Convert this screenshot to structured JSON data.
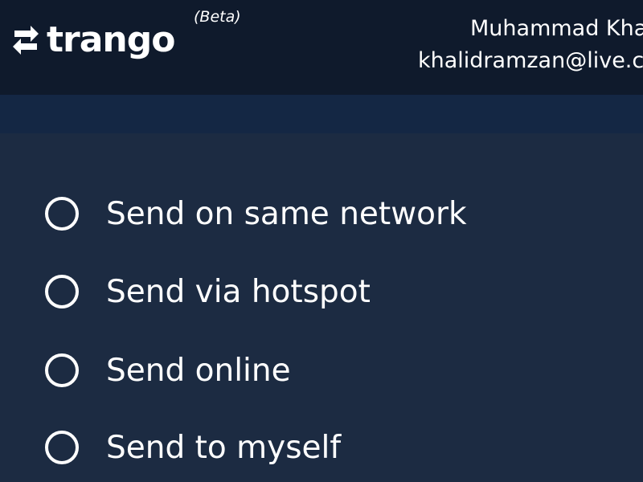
{
  "header": {
    "logo_text": "trango",
    "beta_label": "(Beta)",
    "user_name": "Muhammad Kha",
    "user_email": "khalidramzan@live.co"
  },
  "send_options": [
    {
      "label": "Send on same network"
    },
    {
      "label": "Send via hotspot"
    },
    {
      "label": "Send online"
    },
    {
      "label": "Send to myself"
    }
  ],
  "colors": {
    "header_bg": "#0f1a2c",
    "subbar_bg": "#142744",
    "content_bg": "#1c2b42",
    "text": "#ffffff"
  },
  "icons": {
    "logo": "transfer-arrows-icon",
    "option": "radio-icon"
  }
}
